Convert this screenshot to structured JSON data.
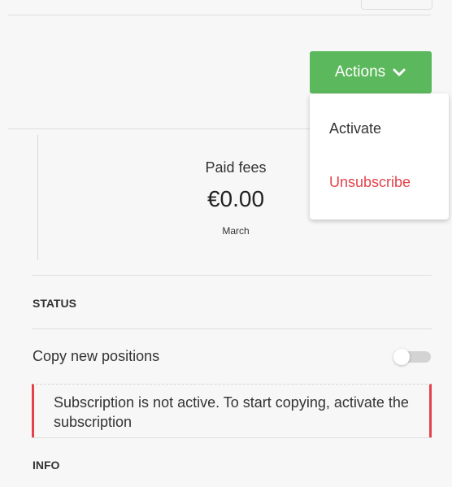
{
  "actions": {
    "label": "Actions",
    "menu": [
      {
        "label": "Activate"
      },
      {
        "label": "Unsubscribe"
      }
    ]
  },
  "fees": {
    "label": "Paid fees",
    "value": "€0.00",
    "period": "March"
  },
  "status": {
    "title": "STATUS",
    "copy_label": "Copy new positions",
    "copy_enabled": false,
    "alert": "Subscription is not active. To start copying, activate the subscription"
  },
  "info": {
    "title": "INFO"
  },
  "colors": {
    "primary_button": "#5cb85c",
    "danger": "#e5414b"
  }
}
